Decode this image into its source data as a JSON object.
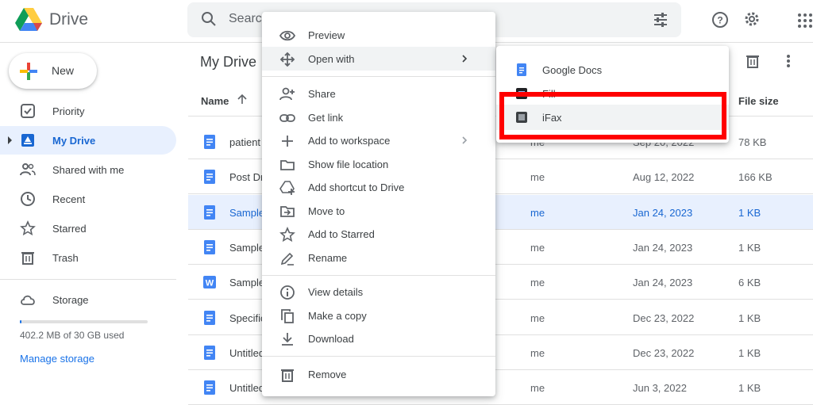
{
  "app": {
    "title": "Drive"
  },
  "search": {
    "placeholder": "Search"
  },
  "new_button": {
    "label": "New"
  },
  "sidebar": {
    "items": [
      {
        "label": "Priority",
        "icon": "priority-icon"
      },
      {
        "label": "My Drive",
        "icon": "my-drive-icon",
        "active": true
      },
      {
        "label": "Shared with me",
        "icon": "shared-icon"
      },
      {
        "label": "Recent",
        "icon": "recent-icon"
      },
      {
        "label": "Starred",
        "icon": "star-icon"
      },
      {
        "label": "Trash",
        "icon": "trash-icon"
      },
      {
        "label": "Storage",
        "icon": "cloud-icon"
      }
    ],
    "storage_used": "402.2 MB of 30 GB used",
    "storage_fraction": 0.013,
    "manage_storage": "Manage storage"
  },
  "main": {
    "breadcrumb": "My Drive",
    "columns": {
      "name": "Name",
      "file_size": "File size"
    },
    "rows": [
      {
        "name": "patient",
        "owner": "me",
        "modified": "Sep 20, 2022",
        "size": "78 KB",
        "type": "doc"
      },
      {
        "name": "Post Dr",
        "owner": "me",
        "modified": "Aug 12, 2022",
        "size": "166 KB",
        "type": "doc"
      },
      {
        "name": "Sample",
        "owner": "me",
        "modified": "Jan 24, 2023",
        "size": "1 KB",
        "type": "doc",
        "selected": true
      },
      {
        "name": "Sample",
        "owner": "me",
        "modified": "Jan 24, 2023",
        "size": "1 KB",
        "type": "doc"
      },
      {
        "name": "Sample",
        "owner": "me",
        "modified": "Jan 24, 2023",
        "size": "6 KB",
        "type": "word"
      },
      {
        "name": "Specific",
        "owner": "me",
        "modified": "Dec 23, 2022",
        "size": "1 KB",
        "type": "doc"
      },
      {
        "name": "Untitled",
        "owner": "me",
        "modified": "Dec 23, 2022",
        "size": "1 KB",
        "type": "doc"
      },
      {
        "name": "Untitled",
        "owner": "me",
        "modified": "Jun 3, 2022",
        "size": "1 KB",
        "type": "doc"
      }
    ]
  },
  "context_menu": {
    "items": [
      {
        "label": "Preview",
        "icon": "eye-icon"
      },
      {
        "label": "Open with",
        "icon": "open-with-icon",
        "submenu": true,
        "hover": true
      },
      {
        "label": "Share",
        "icon": "share-icon"
      },
      {
        "label": "Get link",
        "icon": "link-icon"
      },
      {
        "label": "Add to workspace",
        "icon": "plus-icon",
        "submenu": true
      },
      {
        "label": "Show file location",
        "icon": "folder-icon"
      },
      {
        "label": "Add shortcut to Drive",
        "icon": "shortcut-icon"
      },
      {
        "label": "Move to",
        "icon": "move-icon"
      },
      {
        "label": "Add to Starred",
        "icon": "star-outline-icon"
      },
      {
        "label": "Rename",
        "icon": "rename-icon"
      },
      {
        "label": "View details",
        "icon": "info-icon"
      },
      {
        "label": "Make a copy",
        "icon": "copy-icon"
      },
      {
        "label": "Download",
        "icon": "download-icon"
      },
      {
        "label": "Remove",
        "icon": "trash-icon"
      }
    ]
  },
  "open_with_submenu": {
    "items": [
      {
        "label": "Google Docs",
        "icon": "google-docs-icon"
      },
      {
        "label": "Fill",
        "icon": "fill-app-icon"
      },
      {
        "label": "iFax",
        "icon": "ifax-icon",
        "hover": true
      }
    ]
  },
  "colors": {
    "accent": "#1a73e8",
    "selected_bg": "#e8f0fe",
    "highlight": "#ff0000"
  }
}
